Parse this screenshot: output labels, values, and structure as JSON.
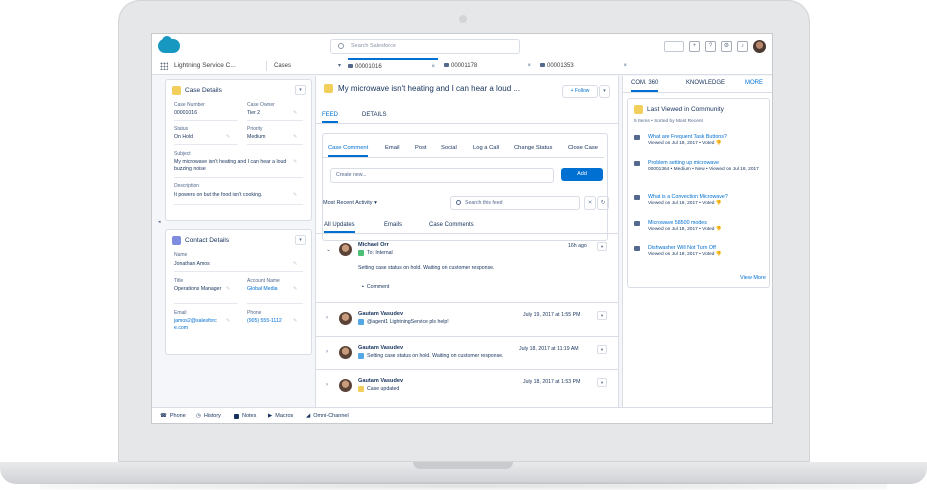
{
  "header": {
    "search_placeholder": "Search Salesforce"
  },
  "nav": {
    "app_name": "Lightning Service C...",
    "object": "Cases",
    "tabs": [
      {
        "label": "00001016"
      },
      {
        "label": "00001178"
      },
      {
        "label": "00001353"
      }
    ],
    "close_glyph": "×",
    "dropdown_glyph": "▾"
  },
  "case_details": {
    "title": "Case Details",
    "fields": {
      "case_number": {
        "label": "Case Number",
        "value": "00001016"
      },
      "case_owner": {
        "label": "Case Owner",
        "value": "Tier 2"
      },
      "status": {
        "label": "Status",
        "value": "On Hold"
      },
      "priority": {
        "label": "Priority",
        "value": "Medium"
      },
      "subject": {
        "label": "Subject",
        "value": "My microwave isn't heating and I can hear a loud buzzing noise"
      },
      "description": {
        "label": "Description",
        "value": "It powers on but the food isn't cooking."
      }
    }
  },
  "contact_details": {
    "title": "Contact Details",
    "fields": {
      "name": {
        "label": "Name",
        "value": "Jonathan Amos"
      },
      "title": {
        "label": "Title",
        "value": "Operations Manager"
      },
      "account_name": {
        "label": "Account Name",
        "value": "Global Media"
      },
      "email": {
        "label": "Email",
        "value": "jamos2@salesforce.com"
      },
      "phone": {
        "label": "Phone",
        "value": "(905) 555-1112"
      }
    }
  },
  "case": {
    "title": "My microwave isn't heating and I can hear a loud ...",
    "follow_label": "+ Follow",
    "tabs": {
      "feed": "FEED",
      "details": "DETAILS"
    }
  },
  "publisher": {
    "tabs": [
      "Case Comment",
      "Email",
      "Post",
      "Social",
      "Log a Call",
      "Change Status",
      "Close Case"
    ],
    "input_placeholder": "Create new...",
    "add_label": "Add"
  },
  "feed": {
    "sort_label": "Most Recent Activity",
    "search_placeholder": "Search this feed",
    "filter_tabs": [
      "All Updates",
      "Emails",
      "Case Comments"
    ],
    "posts": [
      {
        "author": "Michael Orr",
        "target": "To: Internal",
        "time": "16h ago",
        "body": "Setting case status on hold. Waiting on customer response.",
        "comment_label": "Comment"
      },
      {
        "author": "Gautam Vasudev",
        "target": "@agent1 LightningService pls help!",
        "time": "July 19, 2017 at 1:55 PM"
      },
      {
        "author": "Gautam Vasudev",
        "target": "Setting case status on hold. Waiting on customer response.",
        "time": "July 18, 2017 at 11:19 AM"
      },
      {
        "author": "Gautam Vasudev",
        "target": "Case updated",
        "time": "July 18, 2017 at 1:53 PM"
      }
    ]
  },
  "right_panel": {
    "tabs": [
      "COM. 360",
      "KNOWLEDGE",
      "MORE"
    ],
    "card_title": "Last Viewed in Community",
    "meta": "5 Items • Sorted by Most Recent",
    "items": [
      {
        "title": "What are Frequent Task Buttons?",
        "meta": "Viewed on Jul 18, 2017 • Voted 👎"
      },
      {
        "title": "Problem setting up microwave",
        "meta": "00001364 • Medium • New • Viewed on Jul 18, 2017"
      },
      {
        "title": "What is a Convection Microwave?",
        "meta": "Viewed on Jul 18, 2017 • Voted 👎"
      },
      {
        "title": "Microwave 58500 modes",
        "meta": "Viewed on Jul 18, 2017 • Voted 👎"
      },
      {
        "title": "Dishwasher Will Not Turn Off",
        "meta": "Viewed on Jul 18, 2017 • Voted 👎"
      }
    ],
    "view_more": "View More"
  },
  "utility_bar": [
    "Phone",
    "History",
    "Notes",
    "Macros",
    "Omni-Channel"
  ],
  "colors": {
    "brand": "#1798c1",
    "accent": "#0070d2",
    "case_icon": "#f2cf5b",
    "contact_icon": "#7f8de1"
  }
}
